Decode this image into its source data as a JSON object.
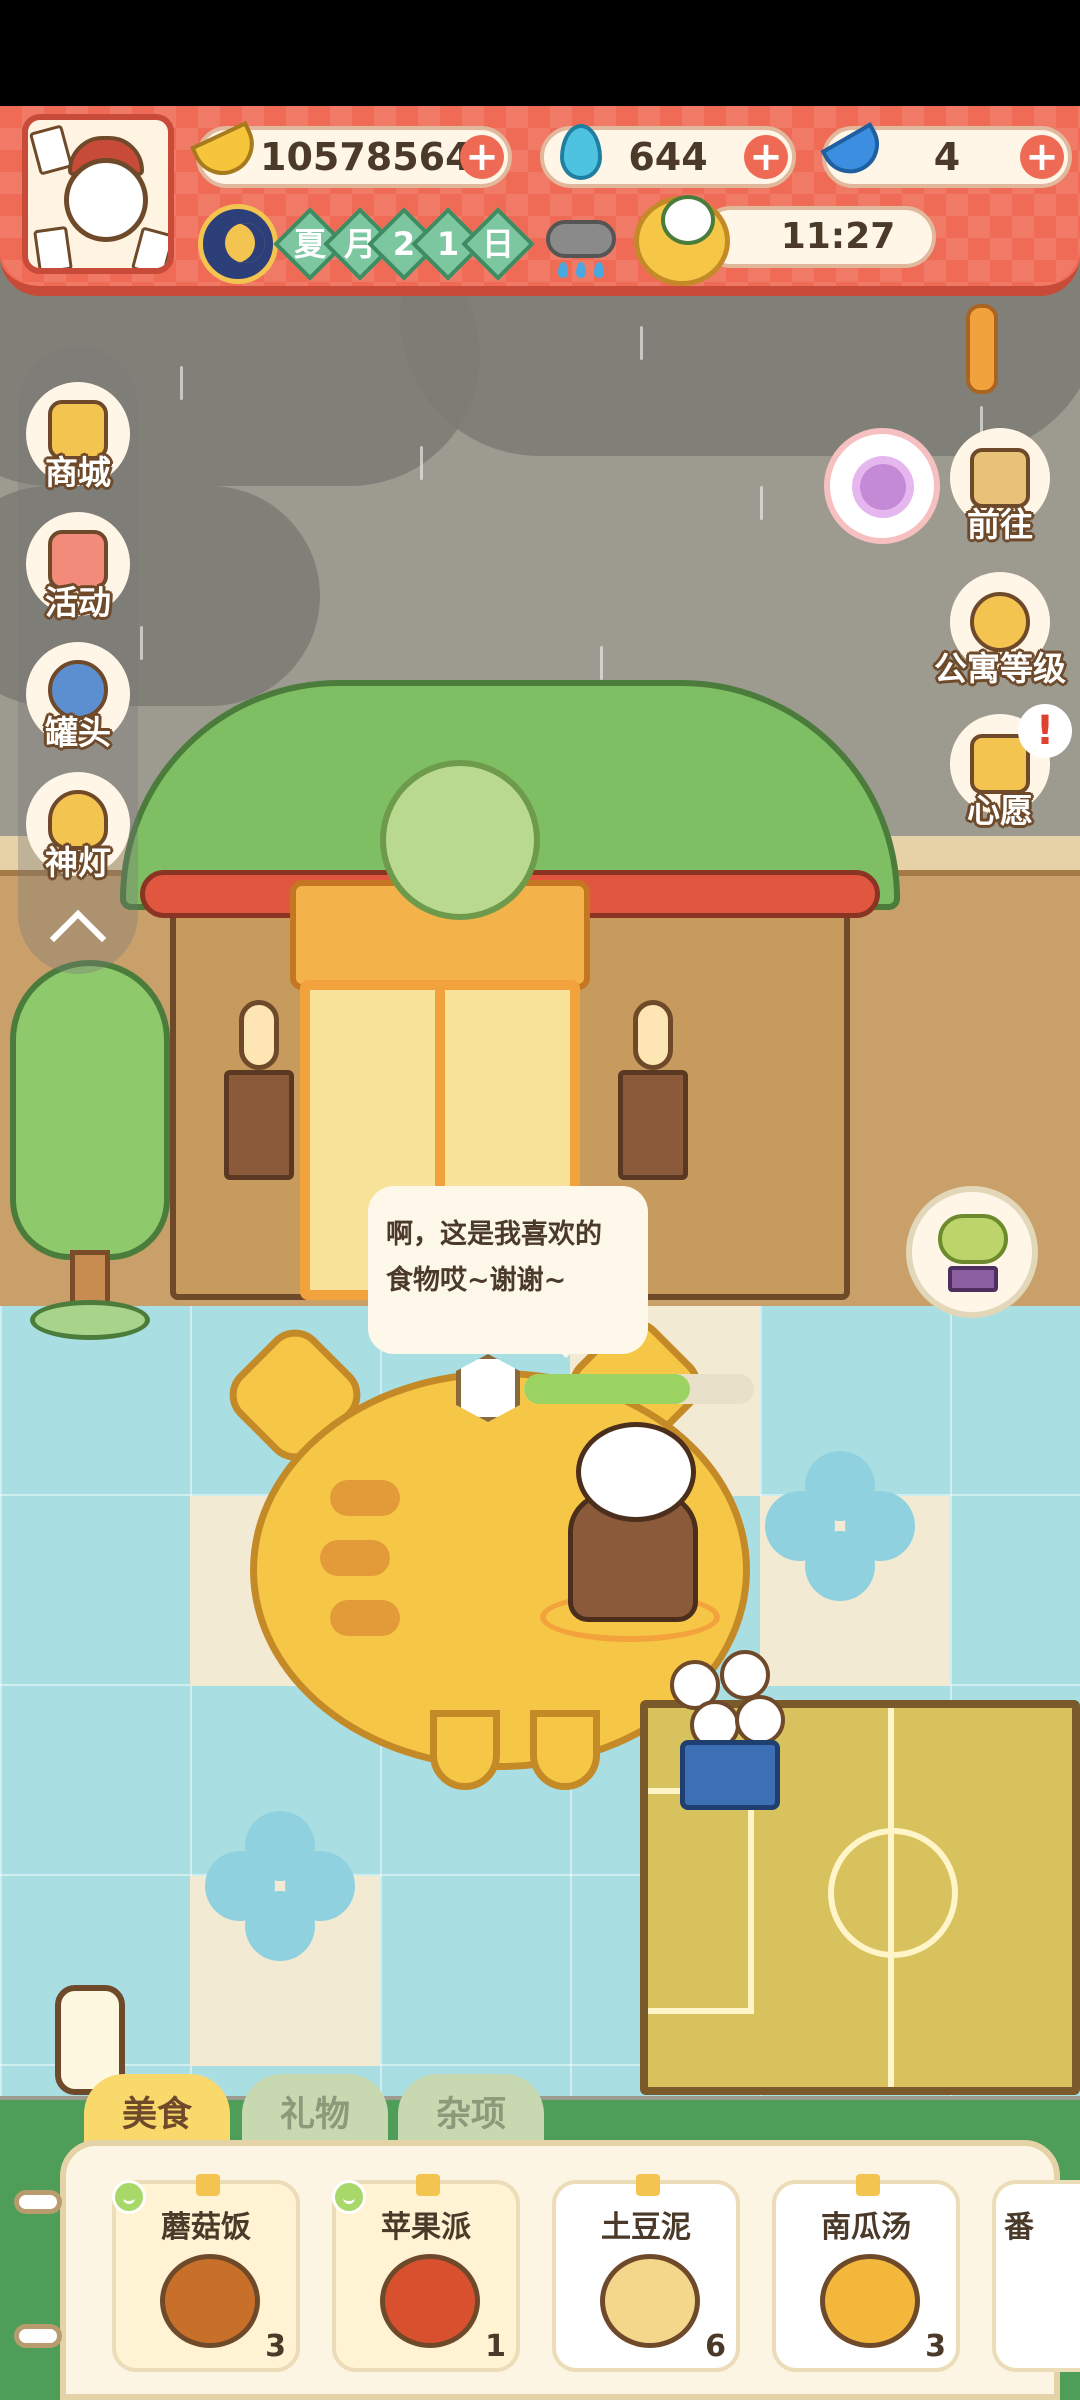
{
  "hud": {
    "bananas": "10578564",
    "flames": "644",
    "blue_bananas": "4",
    "calendar": {
      "season": "夏",
      "month": "月",
      "day_digit_1": "2",
      "day_digit_2": "1",
      "day": "日"
    },
    "weather_icon": "rain-cloud-icon",
    "time": "11:27"
  },
  "left_menu": {
    "items": [
      {
        "label": "商城",
        "icon": "shop-icon"
      },
      {
        "label": "活动",
        "icon": "gift-icon"
      },
      {
        "label": "罐头",
        "icon": "can-icon"
      },
      {
        "label": "神灯",
        "icon": "magic-lamp-icon"
      }
    ]
  },
  "right_menu": {
    "goto_label": "前往",
    "apartment_level_label": "公寓等级",
    "wish_label": "心愿",
    "alert_mark": "!"
  },
  "dialog": {
    "line1": "啊，这是我喜欢的",
    "line2": "食物哎~谢谢~"
  },
  "affection_level": 0.72,
  "tabs": [
    {
      "label": "美食",
      "active": true
    },
    {
      "label": "礼物",
      "active": false
    },
    {
      "label": "杂项",
      "active": false
    }
  ],
  "food_items": [
    {
      "name": "蘑菇饭",
      "count": "3",
      "favorite": true,
      "color": "#c8702a"
    },
    {
      "name": "苹果派",
      "count": "1",
      "favorite": true,
      "color": "#d9502f"
    },
    {
      "name": "土豆泥",
      "count": "6",
      "favorite": false,
      "color": "#f4d78a"
    },
    {
      "name": "南瓜汤",
      "count": "3",
      "favorite": false,
      "color": "#f3b73c"
    },
    {
      "name": "番",
      "count": "",
      "favorite": false,
      "color": "#d9502f"
    }
  ],
  "colors": {
    "hud_red": "#f06b55",
    "gold": "#f6c746",
    "accent_green": "#7cc7a0"
  }
}
